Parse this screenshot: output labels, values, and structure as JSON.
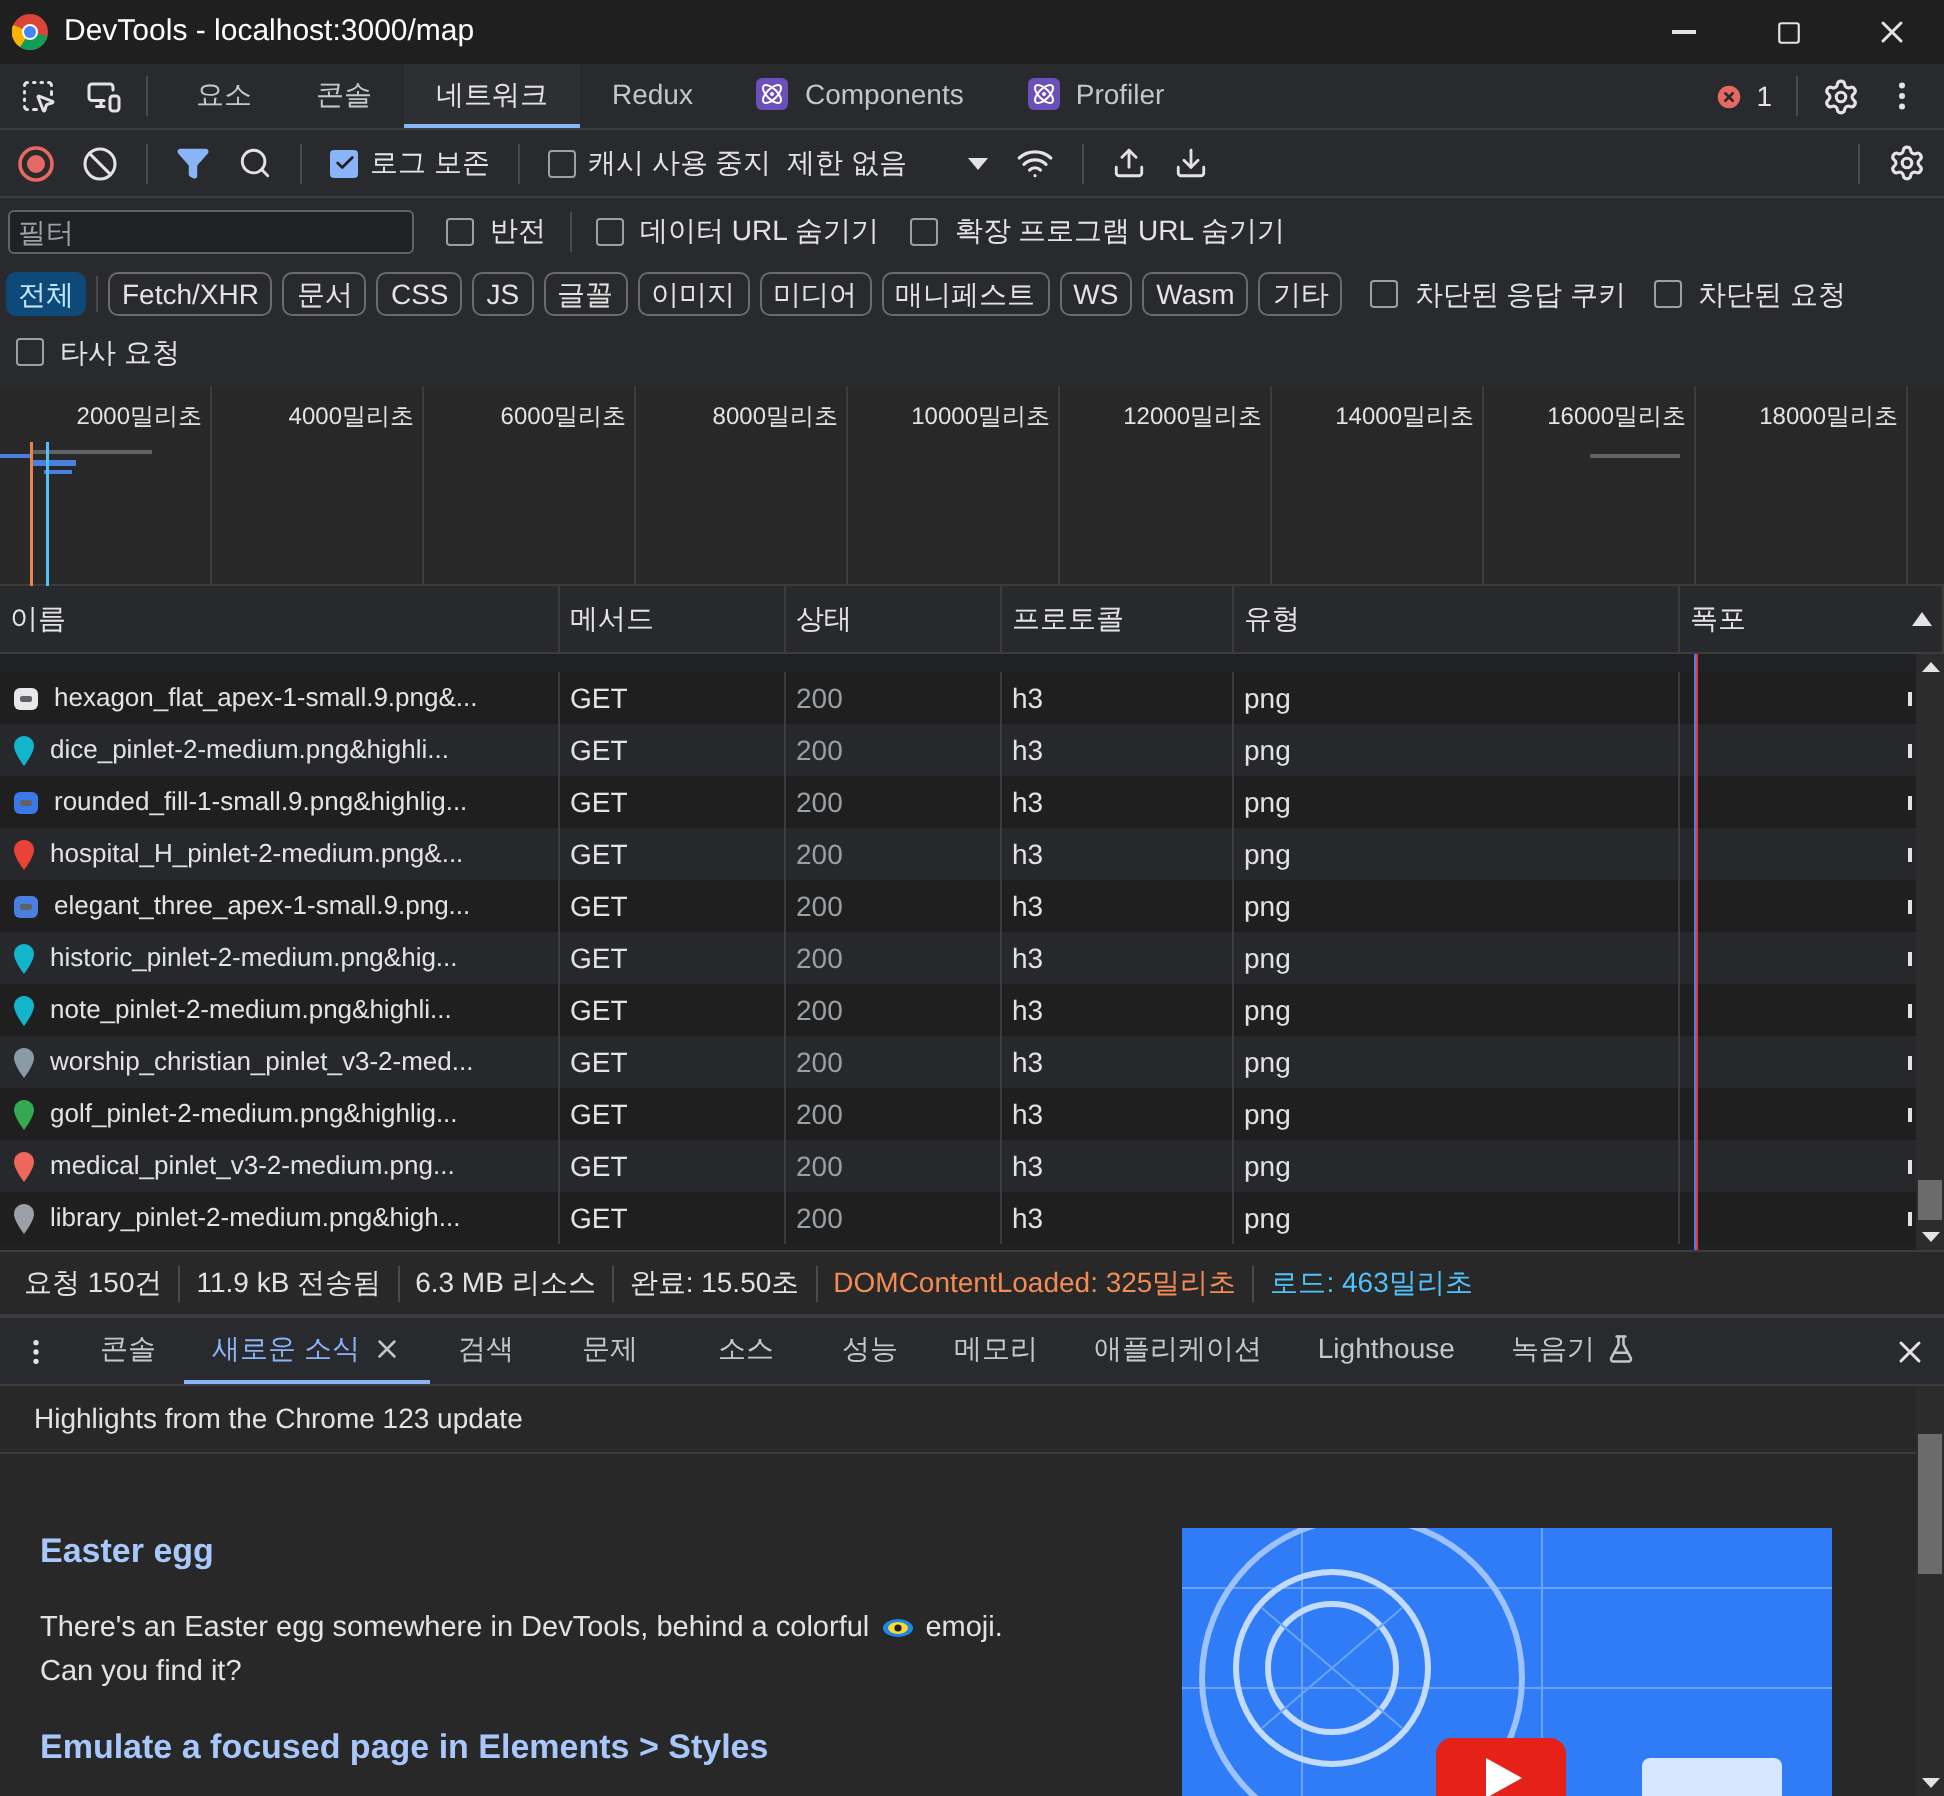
{
  "window": {
    "title": "DevTools - localhost:3000/map"
  },
  "tabs": [
    {
      "label": "요소",
      "selected": false,
      "kind": "plain"
    },
    {
      "label": "콘솔",
      "selected": false,
      "kind": "plain"
    },
    {
      "label": "네트워크",
      "selected": true,
      "kind": "plain"
    },
    {
      "label": "Redux",
      "selected": false,
      "kind": "plain"
    },
    {
      "label": "Components",
      "selected": false,
      "kind": "react"
    },
    {
      "label": "Profiler",
      "selected": false,
      "kind": "react"
    }
  ],
  "error_count": "1",
  "toolbar": {
    "recording": true,
    "preserve_log": {
      "label": "로그 보존",
      "checked": true
    },
    "disable_cache": {
      "label": "캐시 사용 중지",
      "checked": false
    },
    "throttling": "제한 없음"
  },
  "filter_bar": {
    "placeholder": "필터",
    "options": [
      {
        "label": "반전",
        "checked": false
      },
      {
        "label": "데이터 URL 숨기기",
        "checked": false
      },
      {
        "label": "확장 프로그램 URL 숨기기",
        "checked": false
      }
    ]
  },
  "type_filters": [
    {
      "label": "전체",
      "selected": true
    },
    {
      "label": "Fetch/XHR",
      "selected": false
    },
    {
      "label": "문서",
      "selected": false
    },
    {
      "label": "CSS",
      "selected": false
    },
    {
      "label": "JS",
      "selected": false
    },
    {
      "label": "글꼴",
      "selected": false
    },
    {
      "label": "이미지",
      "selected": false
    },
    {
      "label": "미디어",
      "selected": false
    },
    {
      "label": "매니페스트",
      "selected": false
    },
    {
      "label": "WS",
      "selected": false
    },
    {
      "label": "Wasm",
      "selected": false
    },
    {
      "label": "기타",
      "selected": false
    }
  ],
  "extra_filters": [
    {
      "label": "차단된 응답 쿠키",
      "checked": false
    },
    {
      "label": "차단된 요청",
      "checked": false
    },
    {
      "label": "타사 요청",
      "checked": false
    }
  ],
  "timeline": {
    "ticks": [
      "2000밀리초",
      "4000밀리초",
      "6000밀리초",
      "8000밀리초",
      "10000밀리초",
      "12000밀리초",
      "14000밀리초",
      "16000밀리초",
      "18000밀리초"
    ]
  },
  "table": {
    "columns": [
      "이름",
      "메서드",
      "상태",
      "프로토콜",
      "유형",
      "폭포"
    ],
    "rows": [
      {
        "name": "hexagon_flat_apex-1-small.9.png&...",
        "method": "GET",
        "status": "200",
        "protocol": "h3",
        "type": "png",
        "kind": "badge",
        "color": "#e8e8e8"
      },
      {
        "name": "dice_pinlet-2-medium.png&highli...",
        "method": "GET",
        "status": "200",
        "protocol": "h3",
        "type": "png",
        "kind": "pin",
        "color": "#12b5cb"
      },
      {
        "name": "rounded_fill-1-small.9.png&highlig...",
        "method": "GET",
        "status": "200",
        "protocol": "h3",
        "type": "png",
        "kind": "badge",
        "color": "#3b78e7"
      },
      {
        "name": "hospital_H_pinlet-2-medium.png&...",
        "method": "GET",
        "status": "200",
        "protocol": "h3",
        "type": "png",
        "kind": "pin",
        "color": "#ea4335"
      },
      {
        "name": "elegant_three_apex-1-small.9.png...",
        "method": "GET",
        "status": "200",
        "protocol": "h3",
        "type": "png",
        "kind": "badge",
        "color": "#4a7fe0"
      },
      {
        "name": "historic_pinlet-2-medium.png&hig...",
        "method": "GET",
        "status": "200",
        "protocol": "h3",
        "type": "png",
        "kind": "pin",
        "color": "#12b5cb"
      },
      {
        "name": "note_pinlet-2-medium.png&highli...",
        "method": "GET",
        "status": "200",
        "protocol": "h3",
        "type": "png",
        "kind": "pin",
        "color": "#12b5cb"
      },
      {
        "name": "worship_christian_pinlet_v3-2-med...",
        "method": "GET",
        "status": "200",
        "protocol": "h3",
        "type": "png",
        "kind": "pin",
        "color": "#8a9aa6"
      },
      {
        "name": "golf_pinlet-2-medium.png&highlig...",
        "method": "GET",
        "status": "200",
        "protocol": "h3",
        "type": "png",
        "kind": "pin",
        "color": "#34a853"
      },
      {
        "name": "medical_pinlet_v3-2-medium.png...",
        "method": "GET",
        "status": "200",
        "protocol": "h3",
        "type": "png",
        "kind": "pin",
        "color": "#ee675c"
      },
      {
        "name": "library_pinlet-2-medium.png&high...",
        "method": "GET",
        "status": "200",
        "protocol": "h3",
        "type": "png",
        "kind": "pin",
        "color": "#9aa0a6"
      }
    ]
  },
  "status_bar": [
    {
      "text": "요청 150건",
      "kind": "plain"
    },
    {
      "text": "11.9 kB 전송됨",
      "kind": "plain"
    },
    {
      "text": "6.3 MB 리소스",
      "kind": "plain"
    },
    {
      "text": "완료: 15.50초",
      "kind": "plain"
    },
    {
      "text": "DOMContentLoaded: 325밀리초",
      "kind": "dom"
    },
    {
      "text": "로드: 463밀리초",
      "kind": "load"
    }
  ],
  "drawer": {
    "tabs": [
      {
        "label": "콘솔",
        "selected": false,
        "closable": false,
        "kind": "plain"
      },
      {
        "label": "새로운 소식",
        "selected": true,
        "closable": true,
        "kind": "plain"
      },
      {
        "label": "검색",
        "selected": false,
        "closable": false,
        "kind": "plain"
      },
      {
        "label": "문제",
        "selected": false,
        "closable": false,
        "kind": "plain"
      },
      {
        "label": "소스",
        "selected": false,
        "closable": false,
        "kind": "plain"
      },
      {
        "label": "성능",
        "selected": false,
        "closable": false,
        "kind": "plain"
      },
      {
        "label": "메모리",
        "selected": false,
        "closable": false,
        "kind": "plain"
      },
      {
        "label": "애플리케이션",
        "selected": false,
        "closable": false,
        "kind": "plain"
      },
      {
        "label": "Lighthouse",
        "selected": false,
        "closable": false,
        "kind": "plain"
      },
      {
        "label": "녹음기",
        "selected": false,
        "closable": false,
        "kind": "experimental"
      }
    ],
    "header": "Highlights from the Chrome 123 update",
    "sections": [
      {
        "heading": "Easter egg",
        "text_before": "There's an Easter egg somewhere in DevTools, behind a colorful",
        "text_after": "emoji.",
        "text_next": "Can you find it?"
      },
      {
        "heading": "Emulate a focused page in Elements > Styles"
      }
    ]
  }
}
